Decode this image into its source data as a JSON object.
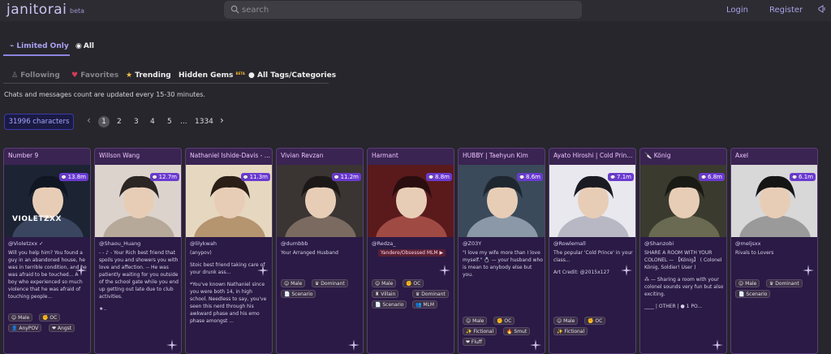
{
  "header": {
    "logo": "janitorai",
    "beta": "beta",
    "search_placeholder": "search",
    "login": "Login",
    "register": "Register"
  },
  "tabs_primary": [
    {
      "label": "Limited Only",
      "active": true
    },
    {
      "label": "All",
      "active": false
    }
  ],
  "tabs_secondary": [
    {
      "label": "Following"
    },
    {
      "label": "Favorites"
    },
    {
      "label": "Trending"
    },
    {
      "label": "Hidden Gems",
      "badge": "BETA"
    },
    {
      "label": "All Tags/Categories"
    }
  ],
  "notice": "Chats and messages count are updated every 15-30 minutes.",
  "character_count": "31996 characters",
  "pagination": {
    "prev": "‹",
    "pages": [
      "1",
      "2",
      "3",
      "4",
      "5"
    ],
    "ellipsis": "...",
    "last": "1334",
    "next": "›"
  },
  "colors": {
    "accent": "#8c83e0",
    "card_bg": "#3a2452",
    "badge": "#6a3ad0"
  },
  "cards": [
    {
      "title": "Number 9",
      "chats": "13.8m",
      "creator": "@Violetzxx ✓",
      "desc": "Will you help him? You found a guy in an abandoned house, he was in terrible condition, and he was afraid to be touched... A boy who experienced so much violence that he was afraid of touching people...",
      "image_text": "VIOLETZXX",
      "tags": [
        "☺ Male",
        "✊ OC",
        "👤 AnyPOV",
        "❤ Angst"
      ]
    },
    {
      "title": "Willson Wang",
      "chats": "12.7m",
      "creator": "@Shaou_Huang",
      "desc": "- - ♪ - Your Rich best friend that spoils you and showers you with love and affection. -- He was patiently waiting for you outside of the school gate while you end up getting out late due to club activities.",
      "desc2": "★..",
      "tags": []
    },
    {
      "title": "Nathaniel Ishide-Davis - ...",
      "chats": "11.3m",
      "creator": "@lilykwah",
      "desc": "(anypov)",
      "desc2": "Stoic best friend taking care of your drunk ass...",
      "desc3": "*You've known Nathaniel since you were both 14, in high school. Needless to say, you've seen this nerd through his awkward phase and his emo phase amongst ...",
      "tags": []
    },
    {
      "title": "Vivian Revzan",
      "chats": "11.2m",
      "creator": "@dumbbb",
      "desc": "Your Arranged Husband",
      "tags": [
        "☺ Male",
        "♛ Dominant",
        "📄 Scenario"
      ]
    },
    {
      "title": "Harmant",
      "chats": "8.8m",
      "creator": "@Redza_",
      "desc": "Yandere/Obsessed MLM ▶",
      "tags": [
        "☺ Male",
        "✊ OC",
        "♜ Villain",
        "♛ Dominant",
        "📄 Scenario",
        "👥 MLM"
      ]
    },
    {
      "title": "HUBBY | Taehyun Kim",
      "chats": "8.6m",
      "creator": "@Z03Y",
      "desc": "\"I love my wife more than I love myself.\" 💍 — your husband who is mean to anybody else but you.",
      "tags": [
        "☺ Male",
        "✊ OC",
        "✨ Fictional",
        "🔥 Smut",
        "❤ Fluff"
      ]
    },
    {
      "title": "Ayato Hiroshi | Cold Prin...",
      "chats": "7.1m",
      "creator": "@Rowlemall",
      "desc": "The popular 'Cold Prince' in your class...",
      "desc2": "Art Credit: @2015x127",
      "tags": [
        "☺ Male",
        "✊ OC",
        "✨ Fictional"
      ]
    },
    {
      "title": "🔪 König",
      "chats": "6.8m",
      "creator": "@Shanzobi",
      "desc": "SHARE A ROOM WITH YOUR COLONEL — 【König】 ( Colonel König, Soldier! User )",
      "desc2": "⁂ — Sharing a room with your colonel sounds very fun but also exciting.",
      "desc3": "____ | OTHER | ● 1 PO...",
      "tags": []
    },
    {
      "title": "Axel",
      "chats": "6.1m",
      "creator": "@meljsxx",
      "desc": "Rivals to Lovers",
      "tags": [
        "☺ Male",
        "♛ Dominant",
        "📄 Scenario"
      ]
    }
  ]
}
